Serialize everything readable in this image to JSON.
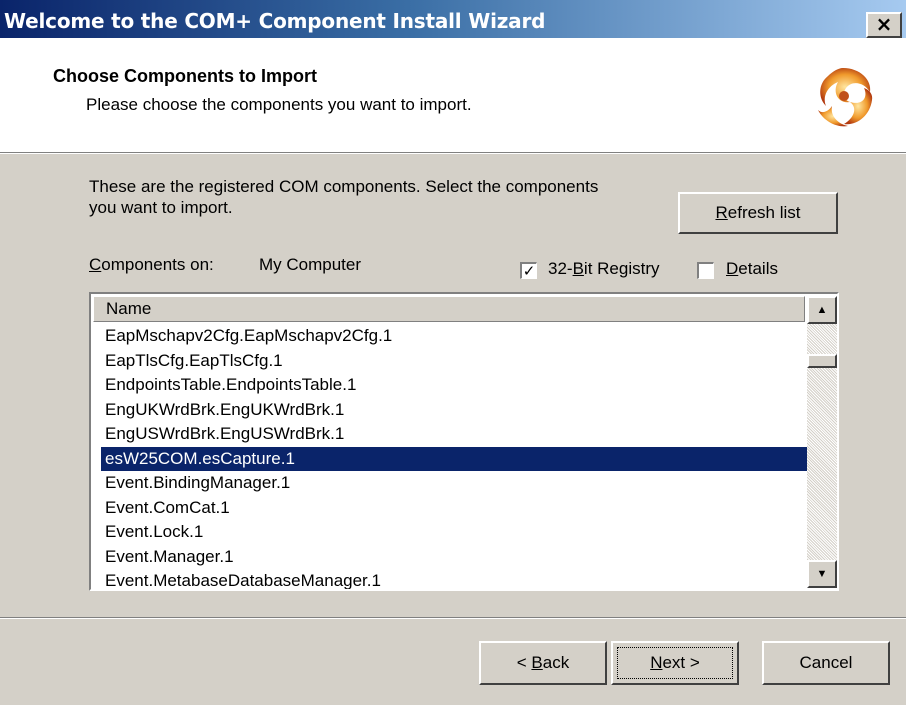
{
  "window": {
    "title": "Welcome to the COM+ Component Install Wizard",
    "close_glyph": "×"
  },
  "header": {
    "title": "Choose Components to Import",
    "subtitle": "Please choose the components you want to import.",
    "logo_icon": "com-plus-swirl-logo"
  },
  "description": "These are the registered COM components.  Select the components you want to import.",
  "refresh_button": {
    "pre": "",
    "underlined": "R",
    "post": "efresh list"
  },
  "components_on": {
    "label_underlined": "C",
    "label_rest": "omponents on:",
    "value": "My Computer"
  },
  "registry_32bit": {
    "checked": true,
    "pre": "32-",
    "underlined": "B",
    "post": "it Registry"
  },
  "details": {
    "checked": false,
    "pre": "",
    "underlined": "D",
    "post": "etails"
  },
  "list": {
    "column_header": "Name",
    "rows": [
      "EapMschapv2Cfg.EapMschapv2Cfg.1",
      "EapTlsCfg.EapTlsCfg.1",
      "EndpointsTable.EndpointsTable.1",
      "EngUKWrdBrk.EngUKWrdBrk.1",
      "EngUSWrdBrk.EngUSWrdBrk.1",
      "esW25COM.esCapture.1",
      "Event.BindingManager.1",
      "Event.ComCat.1",
      "Event.Lock.1",
      "Event.Manager.1",
      "Event.MetabaseDatabaseManager.1"
    ],
    "selected_index": 5,
    "selected_color": "#0a246a"
  },
  "footer": {
    "back": {
      "pre": "< ",
      "underlined": "B",
      "post": "ack"
    },
    "next": {
      "pre": "",
      "underlined": "N",
      "post": "ext >"
    },
    "cancel": "Cancel"
  }
}
